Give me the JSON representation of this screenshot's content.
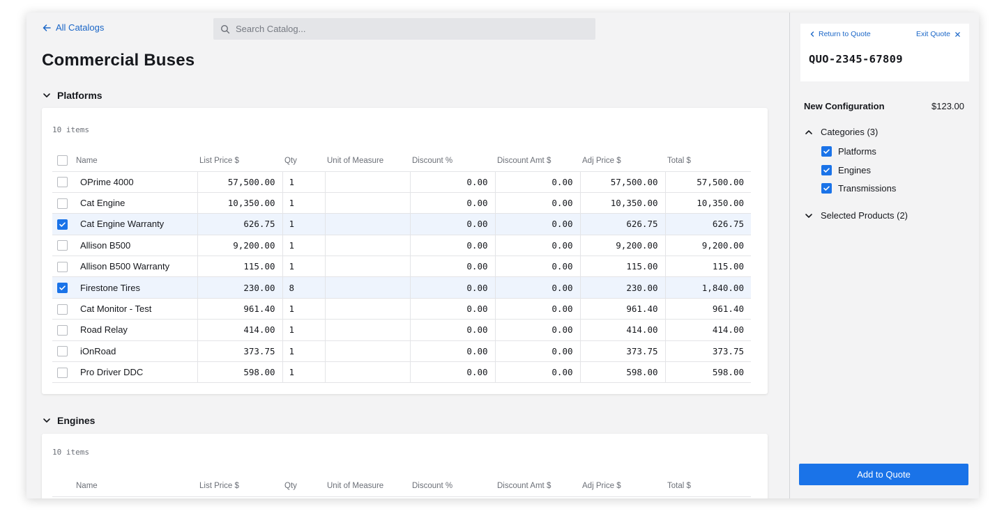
{
  "header": {
    "back_label": "All Catalogs",
    "search_placeholder": "Search Catalog..."
  },
  "page_title": "Commercial Buses",
  "columns": [
    "Name",
    "List Price $",
    "Qty",
    "Unit of Measure",
    "Discount %",
    "Discount Amt $",
    "Adj Price $",
    "Total $"
  ],
  "sections": [
    {
      "title": "Platforms",
      "item_count": "10 items",
      "rows": [
        {
          "name": "OPrime 4000",
          "list_price": "57,500.00",
          "qty": "1",
          "uom": "",
          "discount_pct": "0.00",
          "discount_amt": "0.00",
          "adj_price": "57,500.00",
          "total": "57,500.00",
          "checked": false
        },
        {
          "name": "Cat Engine",
          "list_price": "10,350.00",
          "qty": "1",
          "uom": "",
          "discount_pct": "0.00",
          "discount_amt": "0.00",
          "adj_price": "10,350.00",
          "total": "10,350.00",
          "checked": false
        },
        {
          "name": "Cat Engine Warranty",
          "list_price": "626.75",
          "qty": "1",
          "uom": "",
          "discount_pct": "0.00",
          "discount_amt": "0.00",
          "adj_price": "626.75",
          "total": "626.75",
          "checked": true
        },
        {
          "name": "Allison B500",
          "list_price": "9,200.00",
          "qty": "1",
          "uom": "",
          "discount_pct": "0.00",
          "discount_amt": "0.00",
          "adj_price": "9,200.00",
          "total": "9,200.00",
          "checked": false
        },
        {
          "name": "Allison B500 Warranty",
          "list_price": "115.00",
          "qty": "1",
          "uom": "",
          "discount_pct": "0.00",
          "discount_amt": "0.00",
          "adj_price": "115.00",
          "total": "115.00",
          "checked": false
        },
        {
          "name": "Firestone Tires",
          "list_price": "230.00",
          "qty": "8",
          "uom": "",
          "discount_pct": "0.00",
          "discount_amt": "0.00",
          "adj_price": "230.00",
          "total": "1,840.00",
          "checked": true
        },
        {
          "name": "Cat Monitor - Test",
          "list_price": "961.40",
          "qty": "1",
          "uom": "",
          "discount_pct": "0.00",
          "discount_amt": "0.00",
          "adj_price": "961.40",
          "total": "961.40",
          "checked": false
        },
        {
          "name": "Road Relay",
          "list_price": "414.00",
          "qty": "1",
          "uom": "",
          "discount_pct": "0.00",
          "discount_amt": "0.00",
          "adj_price": "414.00",
          "total": "414.00",
          "checked": false
        },
        {
          "name": "iOnRoad",
          "list_price": "373.75",
          "qty": "1",
          "uom": "",
          "discount_pct": "0.00",
          "discount_amt": "0.00",
          "adj_price": "373.75",
          "total": "373.75",
          "checked": false
        },
        {
          "name": "Pro Driver DDC",
          "list_price": "598.00",
          "qty": "1",
          "uom": "",
          "discount_pct": "0.00",
          "discount_amt": "0.00",
          "adj_price": "598.00",
          "total": "598.00",
          "checked": false
        }
      ]
    },
    {
      "title": "Engines",
      "item_count": "10 items",
      "rows": []
    }
  ],
  "sidebar": {
    "return_label": "Return to Quote",
    "exit_label": "Exit Quote",
    "quote_number": "QUO-2345-67809",
    "new_config_label": "New Configuration",
    "new_config_price": "$123.00",
    "categories_label": "Categories (3)",
    "categories": [
      {
        "label": "Platforms",
        "checked": true
      },
      {
        "label": "Engines",
        "checked": true
      },
      {
        "label": "Transmissions",
        "checked": true
      }
    ],
    "selected_products_label": "Selected Products (2)",
    "add_button_label": "Add to Quote"
  },
  "colors": {
    "accent": "#1a73e8",
    "link": "#1a66c7",
    "selected_row": "#eef4fd"
  }
}
